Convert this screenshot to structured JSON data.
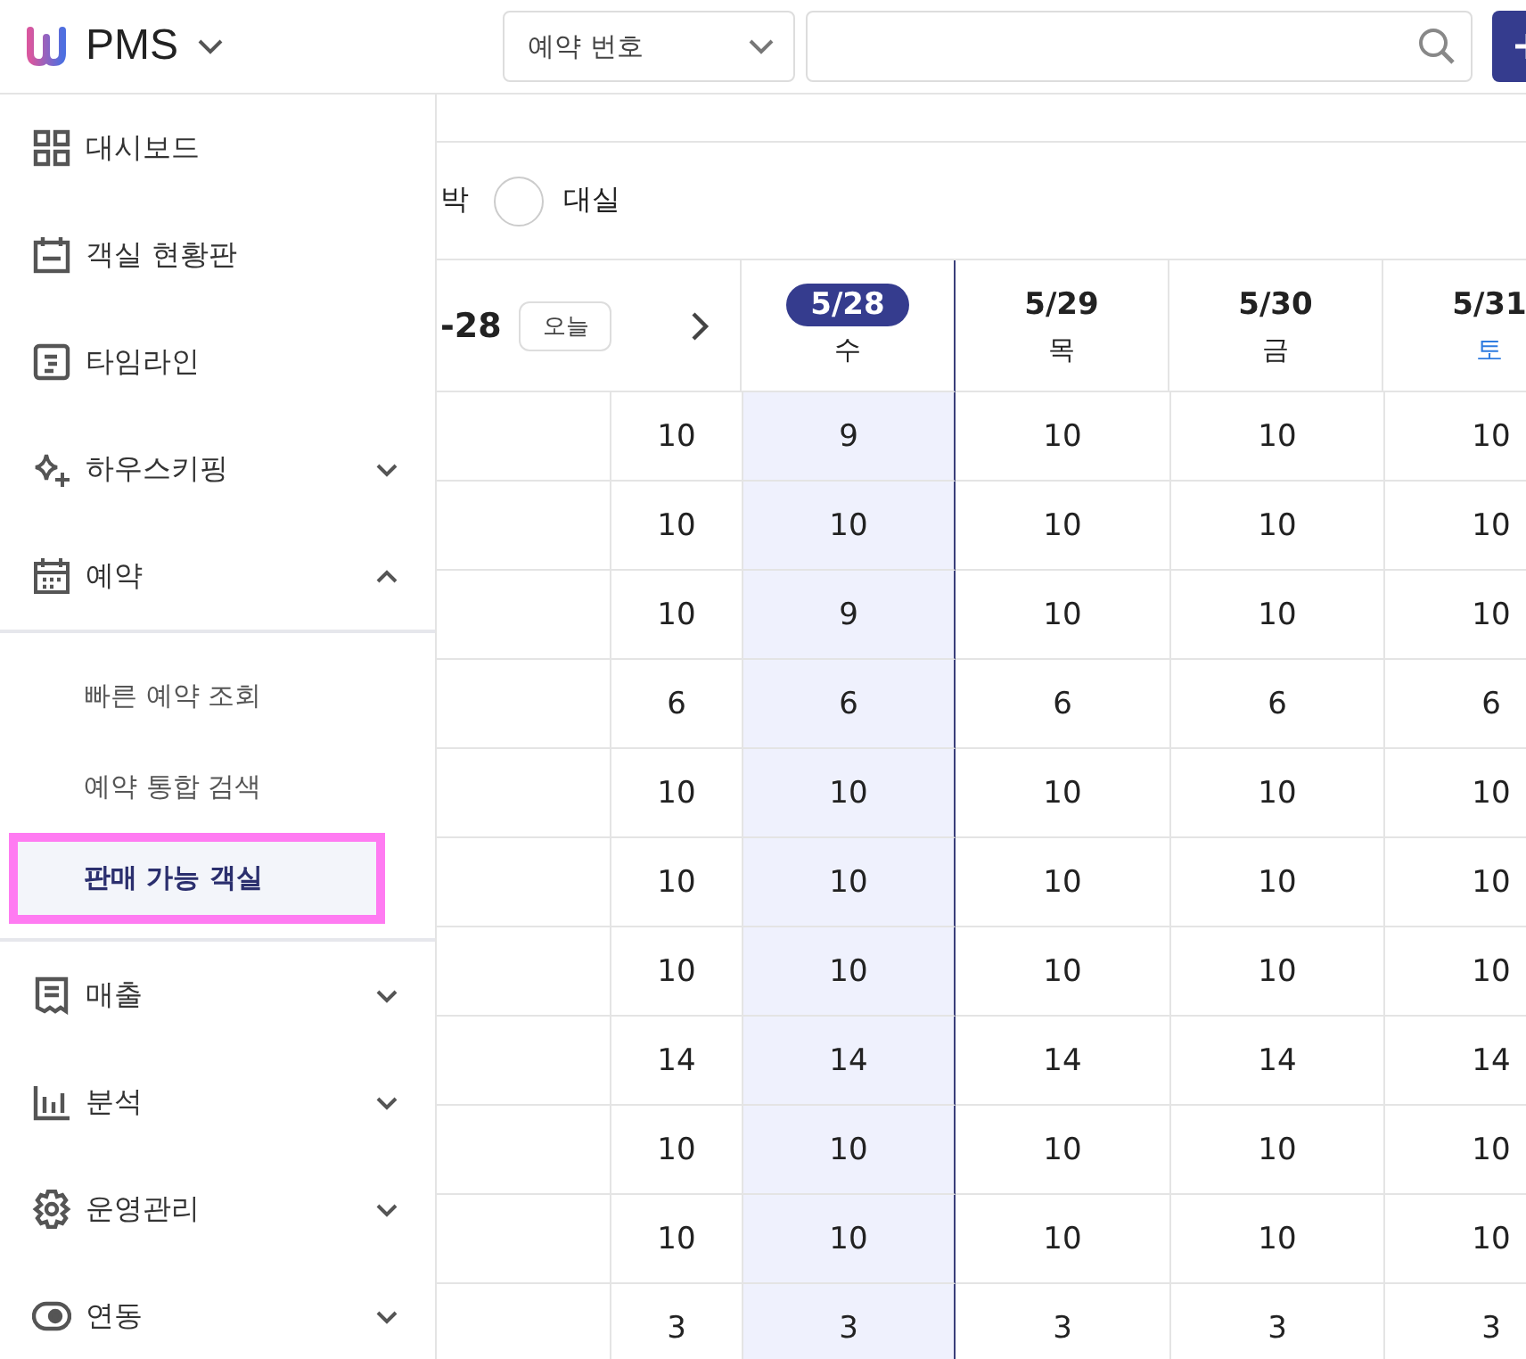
{
  "header": {
    "app_name": "PMS",
    "search_type": "예약 번호"
  },
  "sidebar": {
    "items": [
      {
        "label": "대시보드"
      },
      {
        "label": "객실 현황판"
      },
      {
        "label": "타임라인"
      },
      {
        "label": "하우스키핑",
        "expanded": false
      },
      {
        "label": "예약",
        "expanded": true,
        "children": [
          {
            "label": "빠른 예약 조회",
            "selected": false
          },
          {
            "label": "예약 통합 검색",
            "selected": false
          },
          {
            "label": "판매 가능 객실",
            "selected": true
          }
        ]
      },
      {
        "label": "매출",
        "expanded": false
      },
      {
        "label": "분석",
        "expanded": false
      },
      {
        "label": "운영관리",
        "expanded": false
      },
      {
        "label": "연동",
        "expanded": false
      }
    ]
  },
  "filter": {
    "cut_label": "박",
    "options": [
      {
        "label": "대실",
        "selected": false
      }
    ]
  },
  "calendar": {
    "range_end": "-28",
    "today_button": "오늘",
    "days": [
      {
        "date": "5/28",
        "weekday": "수",
        "today": true,
        "weekend": false
      },
      {
        "date": "5/29",
        "weekday": "목",
        "today": false,
        "weekend": false
      },
      {
        "date": "5/30",
        "weekday": "금",
        "today": false,
        "weekend": false
      },
      {
        "date": "5/31",
        "weekday": "토",
        "today": false,
        "weekend": true
      }
    ],
    "rows": [
      {
        "total": "10",
        "counts": [
          "9",
          "10",
          "10",
          "10"
        ]
      },
      {
        "total": "10",
        "counts": [
          "10",
          "10",
          "10",
          "10"
        ]
      },
      {
        "total": "10",
        "counts": [
          "9",
          "10",
          "10",
          "10"
        ]
      },
      {
        "total": "6",
        "counts": [
          "6",
          "6",
          "6",
          "6"
        ]
      },
      {
        "total": "10",
        "counts": [
          "10",
          "10",
          "10",
          "10"
        ]
      },
      {
        "total": "10",
        "counts": [
          "10",
          "10",
          "10",
          "10"
        ]
      },
      {
        "total": "10",
        "counts": [
          "10",
          "10",
          "10",
          "10"
        ]
      },
      {
        "total": "14",
        "counts": [
          "14",
          "14",
          "14",
          "14"
        ]
      },
      {
        "total": "10",
        "counts": [
          "10",
          "10",
          "10",
          "10"
        ]
      },
      {
        "total": "10",
        "counts": [
          "10",
          "10",
          "10",
          "10"
        ]
      },
      {
        "total": "3",
        "counts": [
          "3",
          "3",
          "3",
          "3"
        ]
      }
    ]
  }
}
